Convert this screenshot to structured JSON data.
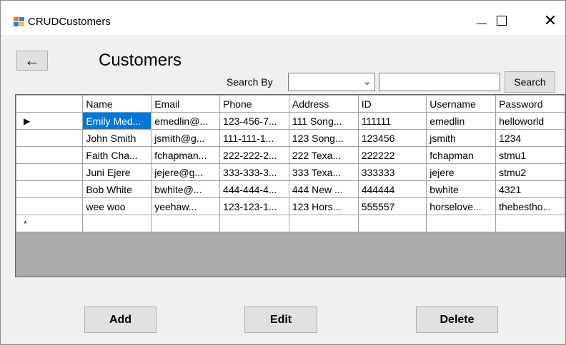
{
  "window": {
    "title": "CRUDCustomers",
    "icon": "app-form-icon"
  },
  "controls": {
    "minimize": "minimize-icon",
    "maximize": "maximize-icon",
    "close": "close-icon"
  },
  "header": {
    "back_label": "←",
    "title": "Customers"
  },
  "search": {
    "label": "Search By",
    "combo_value": "",
    "combo_icon": "chevron-down-icon",
    "input_value": "",
    "button_label": "Search"
  },
  "grid": {
    "columns": [
      "Name",
      "Email",
      "Phone",
      "Address",
      "ID",
      "Username",
      "Password"
    ],
    "rows": [
      [
        "Emily Med...",
        "emedlin@...",
        "123-456-7...",
        "111 Song...",
        "111111",
        "emedlin",
        "helloworld"
      ],
      [
        "John Smith",
        "jsmith@g...",
        "111-111-1...",
        "123 Song...",
        "123456",
        "jsmith",
        "1234"
      ],
      [
        "Faith Cha...",
        "fchapman...",
        "222-222-2...",
        "222 Texa...",
        "222222",
        "fchapman",
        "stmu1"
      ],
      [
        "Juni Ejere",
        "jejere@g...",
        "333-333-3...",
        "333 Texa...",
        "333333",
        "jejere",
        "stmu2"
      ],
      [
        "Bob White",
        "bwhite@...",
        "444-444-4...",
        "444 New ...",
        "444444",
        "bwhite",
        "4321"
      ],
      [
        "wee woo",
        "yeehaw...",
        "123-123-1...",
        "123 Hors...",
        "555557",
        "horselove...",
        "thebestho..."
      ]
    ],
    "current_row_marker": "▶",
    "new_row_marker": "*",
    "selection_color": "#0078d7"
  },
  "buttons": {
    "add": "Add",
    "edit": "Edit",
    "delete": "Delete"
  }
}
